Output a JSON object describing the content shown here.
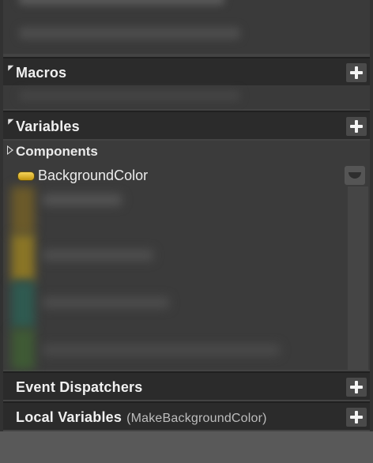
{
  "sections": {
    "macros": {
      "title": "Macros"
    },
    "variables": {
      "title": "Variables"
    },
    "components": {
      "label": "Components"
    },
    "variable_item": {
      "name": "BackgroundColor",
      "type_color": "#e8c32a"
    },
    "event_dispatchers": {
      "title": "Event Dispatchers"
    },
    "local_variables": {
      "title": "Local Variables",
      "context": "(MakeBackgroundColor)"
    }
  },
  "icons": {
    "add": "plus-icon",
    "expand": "triangle-right-icon",
    "collapse": "triangle-down-icon",
    "visibility": "eye-closed-icon",
    "variable_type": "variable-pill-icon"
  },
  "colors": {
    "panel_bg": "#434343",
    "header_bg": "#2b2b2b",
    "pill_yellow": "#e8c32a"
  }
}
